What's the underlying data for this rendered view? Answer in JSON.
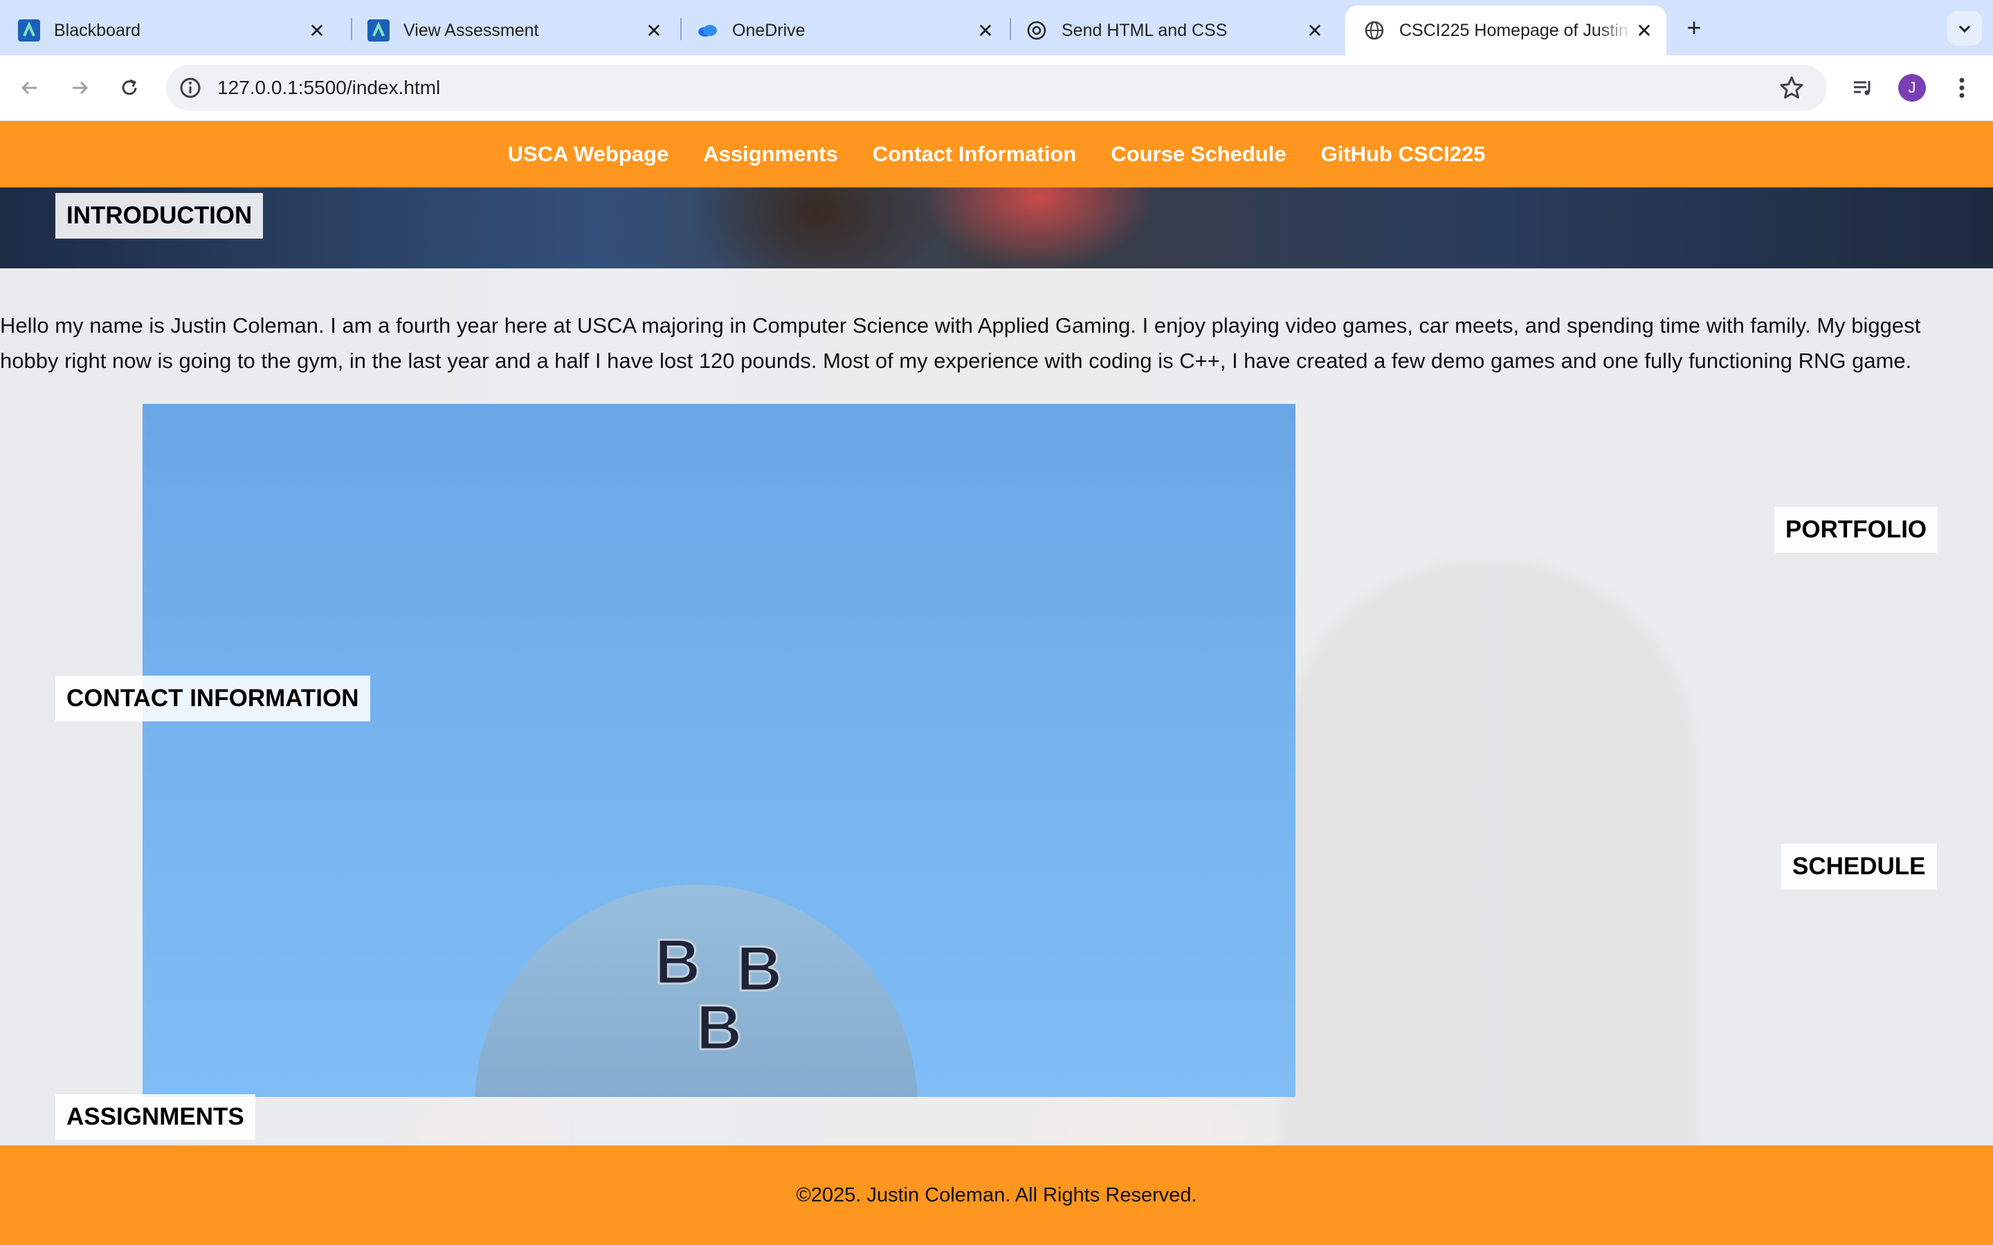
{
  "browser": {
    "tabs": [
      {
        "title": "Blackboard",
        "icon": "blackboard-icon"
      },
      {
        "title": "View Assessment",
        "icon": "blackboard-icon"
      },
      {
        "title": "OneDrive",
        "icon": "onedrive-icon"
      },
      {
        "title": "Send HTML and CSS",
        "icon": "chatgpt-icon"
      },
      {
        "title": "CSCI225 Homepage of Justin",
        "icon": "globe-icon"
      }
    ],
    "url": "127.0.0.1:5500/index.html",
    "profile_initial": "J"
  },
  "site": {
    "nav": [
      "USCA Webpage",
      "Assignments",
      "Contact Information",
      "Course Schedule",
      "GitHub CSCI225"
    ],
    "sections": {
      "introduction": "INTRODUCTION",
      "contact": "CONTACT INFORMATION",
      "portfolio": "PORTFOLIO",
      "schedule": "SCHEDULE",
      "assignments": "ASSIGNMENTS"
    },
    "intro_paragraph": "Hello my name is Justin Coleman. I am a fourth year here at USCA majoring in Computer Science with Applied Gaming. I enjoy playing video games, car meets, and spending time with family. My biggest hobby right now is going to the gym, in the last year and a half I have lost 120 pounds. Most of my experience with coding is C++, I have created a few demo games and one fully functioning RNG game.",
    "cap_letters": [
      "B",
      "B",
      "B"
    ],
    "footer": "©2025. Justin Coleman. All Rights Reserved."
  },
  "colors": {
    "nav_orange": "#ff961f",
    "tabbar": "#d3e3fd"
  }
}
